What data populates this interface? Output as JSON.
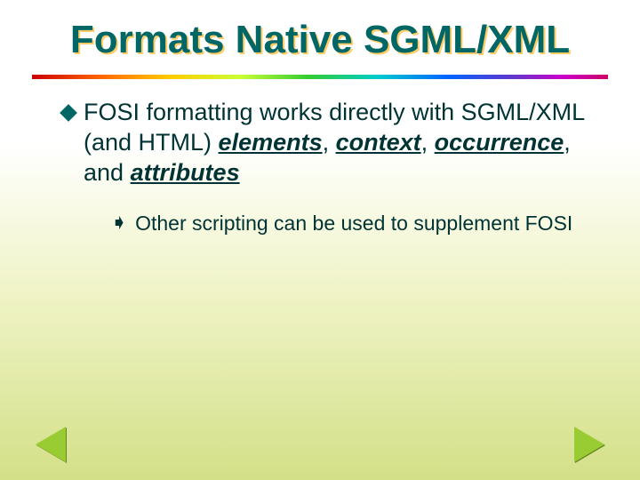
{
  "title": "Formats Native SGML/XML",
  "bullet": {
    "part1": "FOSI formatting works directly with SGML/XML (and HTML) ",
    "em1": "elements",
    "sep1": ", ",
    "em2": "context",
    "sep2": ", ",
    "em3": "occurrence",
    "sep3": ", and ",
    "em4": "attributes"
  },
  "sub": {
    "marker": "➧",
    "text": "Other scripting can be used to supplement FOSI"
  },
  "nav": {
    "prev": "previous-slide",
    "next": "next-slide"
  }
}
